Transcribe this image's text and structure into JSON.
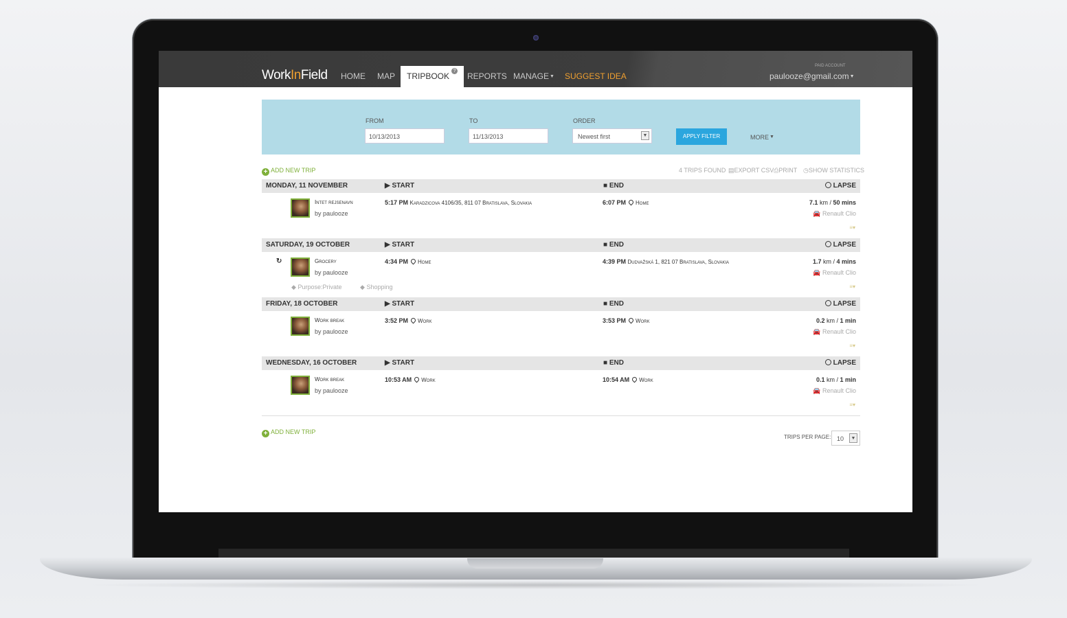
{
  "app": {
    "logo_a": "Work",
    "logo_b": "In",
    "logo_c": "Field"
  },
  "nav": {
    "home": "HOME",
    "map": "MAP",
    "tripbook": "TRIPBOOK",
    "reports": "REPORTS",
    "manage": "MANAGE",
    "suggest": "SUGGEST IDEA"
  },
  "account": {
    "badge": "PAID ACCOUNT",
    "email": "paulooze@gmail.com"
  },
  "filter": {
    "from_label": "FROM",
    "from_value": "10/13/2013",
    "to_label": "TO",
    "to_value": "11/13/2013",
    "order_label": "ORDER",
    "order_value": "Newest first",
    "apply_label": "APPLY FILTER",
    "more_label": "MORE"
  },
  "toolbar": {
    "add_trip": "ADD NEW TRIP",
    "found": "4 TRIPS FOUND",
    "export": "EXPORT CSV",
    "print": "PRINT",
    "stats": "SHOW STATISTICS"
  },
  "columns": {
    "start": "START",
    "end": "END",
    "lapse": "LAPSE"
  },
  "days": [
    {
      "date": "MONDAY, 11 NOVEMBER",
      "trip": {
        "name": "Intet rejsenavn",
        "by": "by paulooze",
        "start_time": "5:17 PM",
        "start_loc": "Karadzicova 4106/35, 811 07 Bratislava, Slovakia",
        "end_time": "6:07 PM",
        "end_loc": "Home",
        "dist": "7.1",
        "dist_unit": "km",
        "dur": "50 mins",
        "car": "Renault Clio"
      }
    },
    {
      "date": "SATURDAY, 19 OCTOBER",
      "trip": {
        "name": "Grocery",
        "by": "by paulooze",
        "start_time": "4:34 PM",
        "start_loc": "Home",
        "end_time": "4:39 PM",
        "end_loc": "Dudvažská 1, 821 07 Bratislava, Slovakia",
        "dist": "1.7",
        "dist_unit": "km",
        "dur": "4 mins",
        "car": "Renault Clio",
        "tag1": "Purpose:Private",
        "tag2": "Shopping"
      }
    },
    {
      "date": "FRIDAY, 18 OCTOBER",
      "trip": {
        "name": "Work break",
        "by": "by paulooze",
        "start_time": "3:52 PM",
        "start_loc": "Work",
        "end_time": "3:53 PM",
        "end_loc": "Work",
        "dist": "0.2",
        "dist_unit": "km",
        "dur": "1 min",
        "car": "Renault Clio"
      }
    },
    {
      "date": "WEDNESDAY, 16 OCTOBER",
      "trip": {
        "name": "Work break",
        "by": "by paulooze",
        "start_time": "10:53 AM",
        "start_loc": "Work",
        "end_time": "10:54 AM",
        "end_loc": "Work",
        "dist": "0.1",
        "dist_unit": "km",
        "dur": "1 min",
        "car": "Renault Clio"
      }
    }
  ],
  "footer": {
    "add_trip": "ADD NEW TRIP",
    "per_page_label": "TRIPS PER PAGE:",
    "per_page_value": "10"
  },
  "colors": {
    "accent": "#2ba6de",
    "brand": "#f0a030",
    "add": "#7fb03a",
    "filter_bg": "#b2dbe7"
  }
}
